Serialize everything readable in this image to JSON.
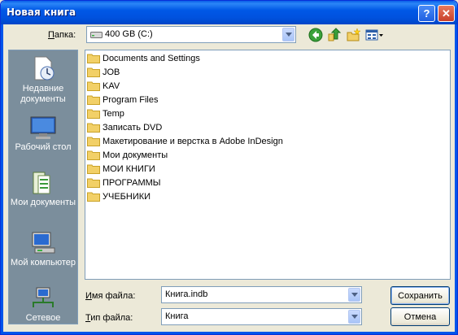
{
  "window": {
    "title": "Новая книга"
  },
  "title_buttons": {
    "help": "?",
    "close": "✕"
  },
  "lookin": {
    "label": "Папка:",
    "label_underline": "П",
    "label_rest": "апка:",
    "value": "400 GB (C:)"
  },
  "toolbar": {
    "back_icon": "back-arrow-icon",
    "up_icon": "up-folder-icon",
    "new_folder_icon": "new-folder-icon",
    "views_icon": "views-menu-icon"
  },
  "places": [
    {
      "label": "Недавние документы",
      "icon": "recent-documents-icon"
    },
    {
      "label": "Рабочий стол",
      "icon": "desktop-icon"
    },
    {
      "label": "Мои документы",
      "icon": "my-documents-icon"
    },
    {
      "label": "Мой компьютер",
      "icon": "my-computer-icon"
    },
    {
      "label": "Сетевое",
      "icon": "network-icon"
    }
  ],
  "files": [
    "Documents and Settings",
    "JOB",
    "KAV",
    "Program Files",
    "Temp",
    "Записать DVD",
    "Макетирование и верстка в Adobe InDesign",
    "Мои документы",
    "МОИ КНИГИ",
    "ПРОГРАММЫ",
    "УЧЕБНИКИ"
  ],
  "filename": {
    "label_underline": "И",
    "label_rest": "мя файла:",
    "value": "Книга.indb"
  },
  "filetype": {
    "label_underline": "Т",
    "label_rest": "ип файла:",
    "value": "Книга"
  },
  "buttons": {
    "save": "Сохранить",
    "cancel": "Отмена"
  },
  "colors": {
    "title_bar": "#0054e3",
    "places_bg": "#7b8e9c",
    "dialog_bg": "#ece9d8",
    "folder": "#f2d067"
  }
}
